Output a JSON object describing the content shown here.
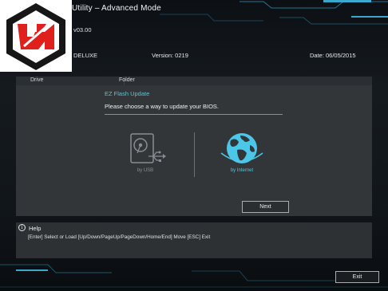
{
  "header": {
    "title_fragment": "Utility – Advanced Mode",
    "version_fragment": "v03.00",
    "model_fragment": "DELUXE",
    "bios_version": "Version:  0219",
    "date": "Date: 06/05/2015"
  },
  "tabs": [
    "Drive",
    "Folder"
  ],
  "ez_flash": {
    "title": "EZ Flash Update",
    "prompt": "Please choose a way to update your BIOS.",
    "options": [
      {
        "label": "by USB",
        "icon": "usb-drive-icon",
        "state": "disabled"
      },
      {
        "label": "by Internet",
        "icon": "globe-icon",
        "state": "selected"
      }
    ],
    "next_label": "Next"
  },
  "help": {
    "icon": "info-icon",
    "title": "Help",
    "keys": "[Enter] Select or Load   [Up/Down/PageUp/PageDown/Home/End] Move   [ESC] Exit"
  },
  "footer": {
    "exit_label": "Exit"
  },
  "colors": {
    "accent": "#4cc7e8",
    "panel": "#333638",
    "background": "#0c1014",
    "logo_red": "#e0201c"
  }
}
